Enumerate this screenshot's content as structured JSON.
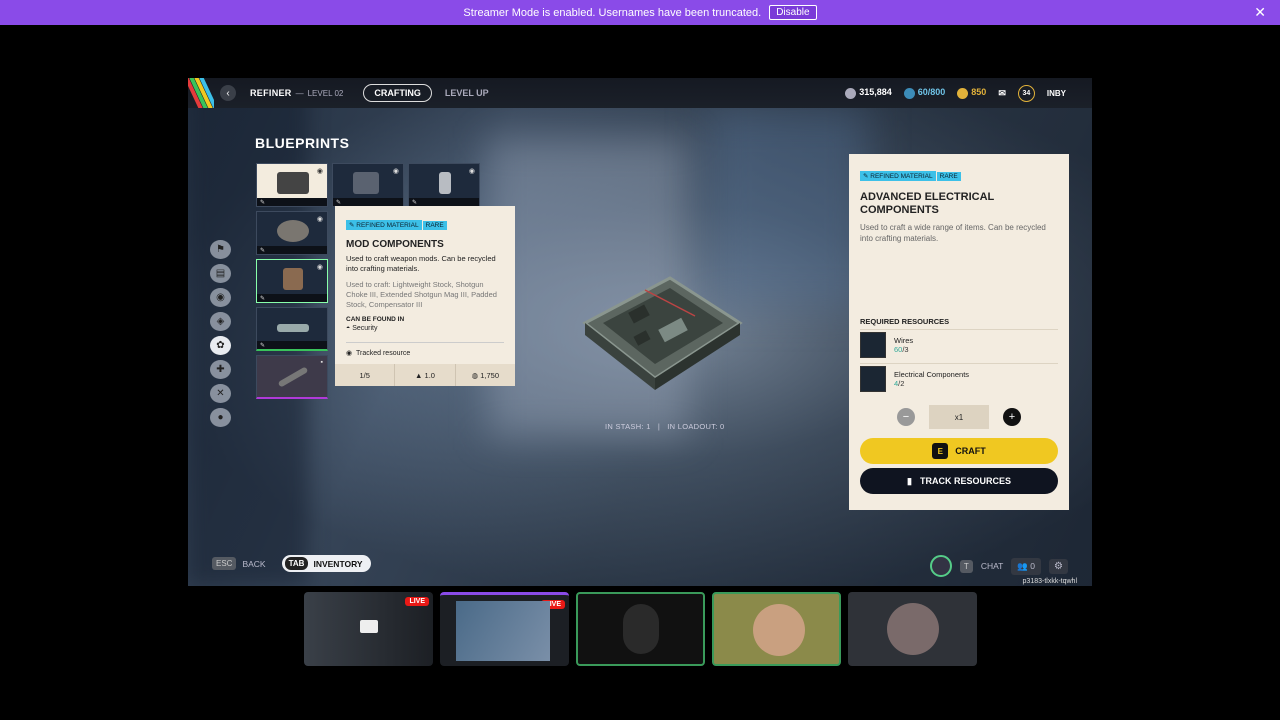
{
  "banner": {
    "message": "Streamer Mode is enabled. Usernames have been truncated.",
    "button": "Disable",
    "close": "✕"
  },
  "topbar": {
    "back": "‹",
    "station": "REFINER",
    "dash": "—",
    "level": "LEVEL 02",
    "tab_active": "CRAFTING",
    "tab_other": "LEVEL UP",
    "credits": "315,884",
    "slots": "60/800",
    "tokens": "850",
    "player_level": "34",
    "player_name": "INBY"
  },
  "blueprints": {
    "title": "BLUEPRINTS"
  },
  "tooltip": {
    "tag1": "REFINED MATERIAL",
    "tag2": "RARE",
    "title": "MOD COMPONENTS",
    "desc": "Used to craft weapon mods. Can be recycled into crafting materials.",
    "used": "Used to craft: Lightweight Stock, Shotgun Choke III, Extended Shotgun Mag III, Padded Stock, Compensator III",
    "found_label": "CAN BE FOUND IN",
    "found_value": "Security",
    "tracked": "Tracked resource",
    "stack": "1/5",
    "weight": "1.0",
    "value": "1,750"
  },
  "preview": {
    "stash": "IN STASH: 1",
    "sep": "|",
    "loadout": "IN LOADOUT: 0"
  },
  "panel": {
    "tag1": "REFINED MATERIAL",
    "tag2": "RARE",
    "title": "ADVANCED ELECTRICAL COMPONENTS",
    "desc": "Used to craft a wide range of items. Can be recycled into crafting materials.",
    "req_title": "REQUIRED RESOURCES",
    "resources": [
      {
        "name": "Wires",
        "have": "60",
        "need": "/3"
      },
      {
        "name": "Electrical Components",
        "have": "4",
        "need": "/2"
      }
    ],
    "qty": "x1",
    "minus": "−",
    "plus": "+",
    "craft_key": "E",
    "craft": "CRAFT",
    "track": "TRACK RESOURCES"
  },
  "bottom": {
    "esc": "ESC",
    "back": "BACK",
    "tab": "TAB",
    "inventory": "INVENTORY",
    "t": "T",
    "chat": "CHAT",
    "party": "0",
    "session": "p3183-tlxkk-tqwhl"
  },
  "tiles": {
    "live": "LIVE"
  },
  "colors": {
    "banner": "#8a4be8",
    "craft": "#f0c821",
    "tag": "#3cc0e8",
    "panel": "#f3ece0"
  }
}
